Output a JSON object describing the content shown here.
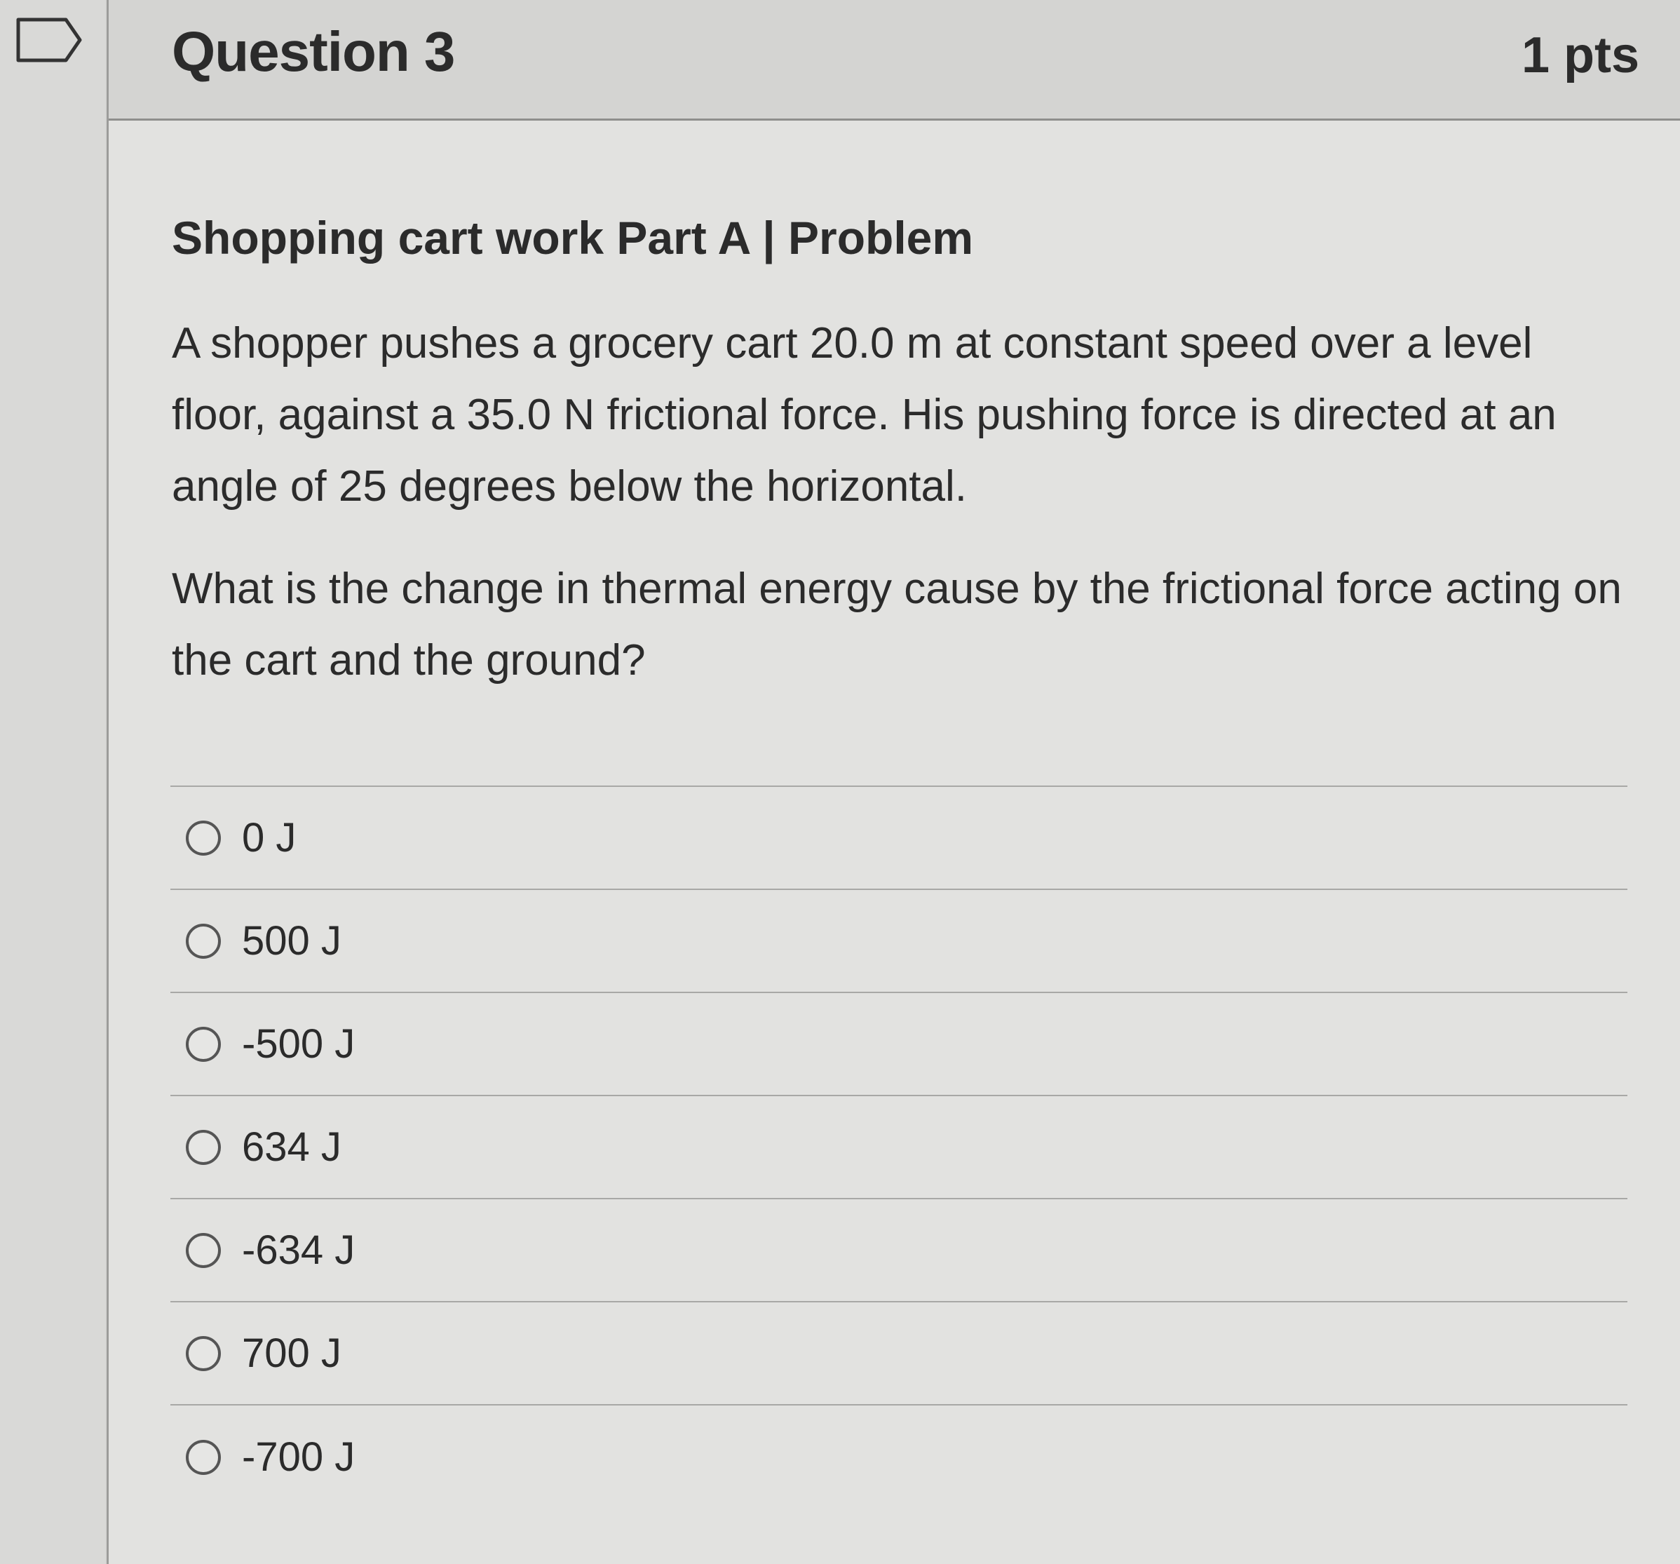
{
  "header": {
    "question_title": "Question 3",
    "points": "1 pts"
  },
  "problem": {
    "heading": "Shopping cart work Part A | Problem",
    "text": "A shopper pushes a grocery cart 20.0 m at constant speed over a level floor, against a 35.0 N frictional force.  His pushing force is directed at an angle of 25 degrees below the horizontal.",
    "question": "What is the change in thermal energy cause by the frictional force acting on the cart and the ground?"
  },
  "answers": [
    {
      "label": "0 J"
    },
    {
      "label": "500 J"
    },
    {
      "label": "-500 J"
    },
    {
      "label": "634 J"
    },
    {
      "label": "-634 J"
    },
    {
      "label": "700 J"
    },
    {
      "label": "-700 J"
    }
  ],
  "icons": {
    "flag": "flag-icon",
    "radio": "radio-button-icon"
  },
  "colors": {
    "background": "#e2e2e0",
    "header": "#d4d4d2",
    "text": "#2b2b2b"
  }
}
